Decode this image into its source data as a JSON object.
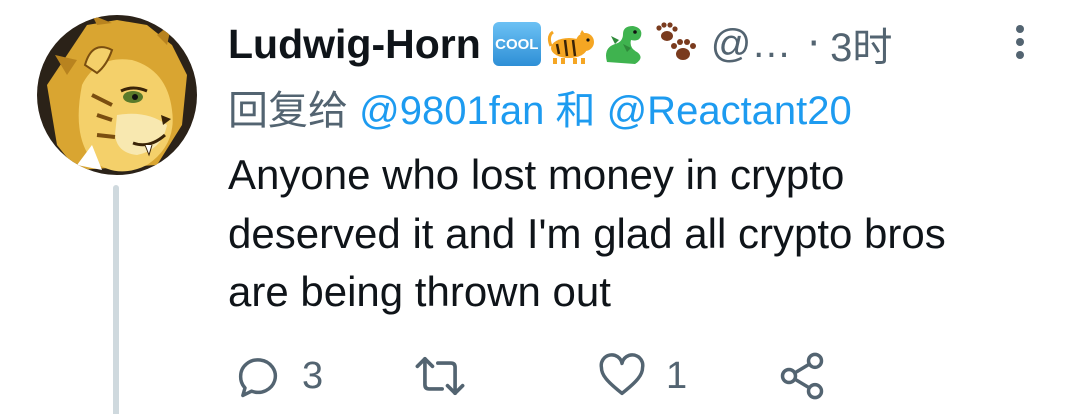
{
  "tweet": {
    "display_name": "Ludwig-Horn",
    "badges": {
      "cool_text": "COOL",
      "icons": [
        "cool-button-emoji",
        "tiger-emoji",
        "dragon-emoji",
        "paw-prints-emoji"
      ]
    },
    "handle": "@…",
    "separator": "·",
    "timestamp": "3时",
    "reply_prefix": "回复给",
    "reply_mention_1": "@9801fan",
    "reply_conjunction": "和",
    "reply_mention_2": "@Reactant20",
    "text_lines": [
      "Anyone who lost money in crypto",
      "deserved it and I'm glad all crypto bros",
      "are being thrown out"
    ],
    "actions": {
      "reply_count": "3",
      "retweet_count": "",
      "like_count": "1",
      "share_count": ""
    }
  },
  "colors": {
    "primary_text": "#0f1419",
    "secondary_text": "#536471",
    "link": "#1d9bf0",
    "thread_line": "#cfd9de",
    "background": "#ffffff"
  }
}
